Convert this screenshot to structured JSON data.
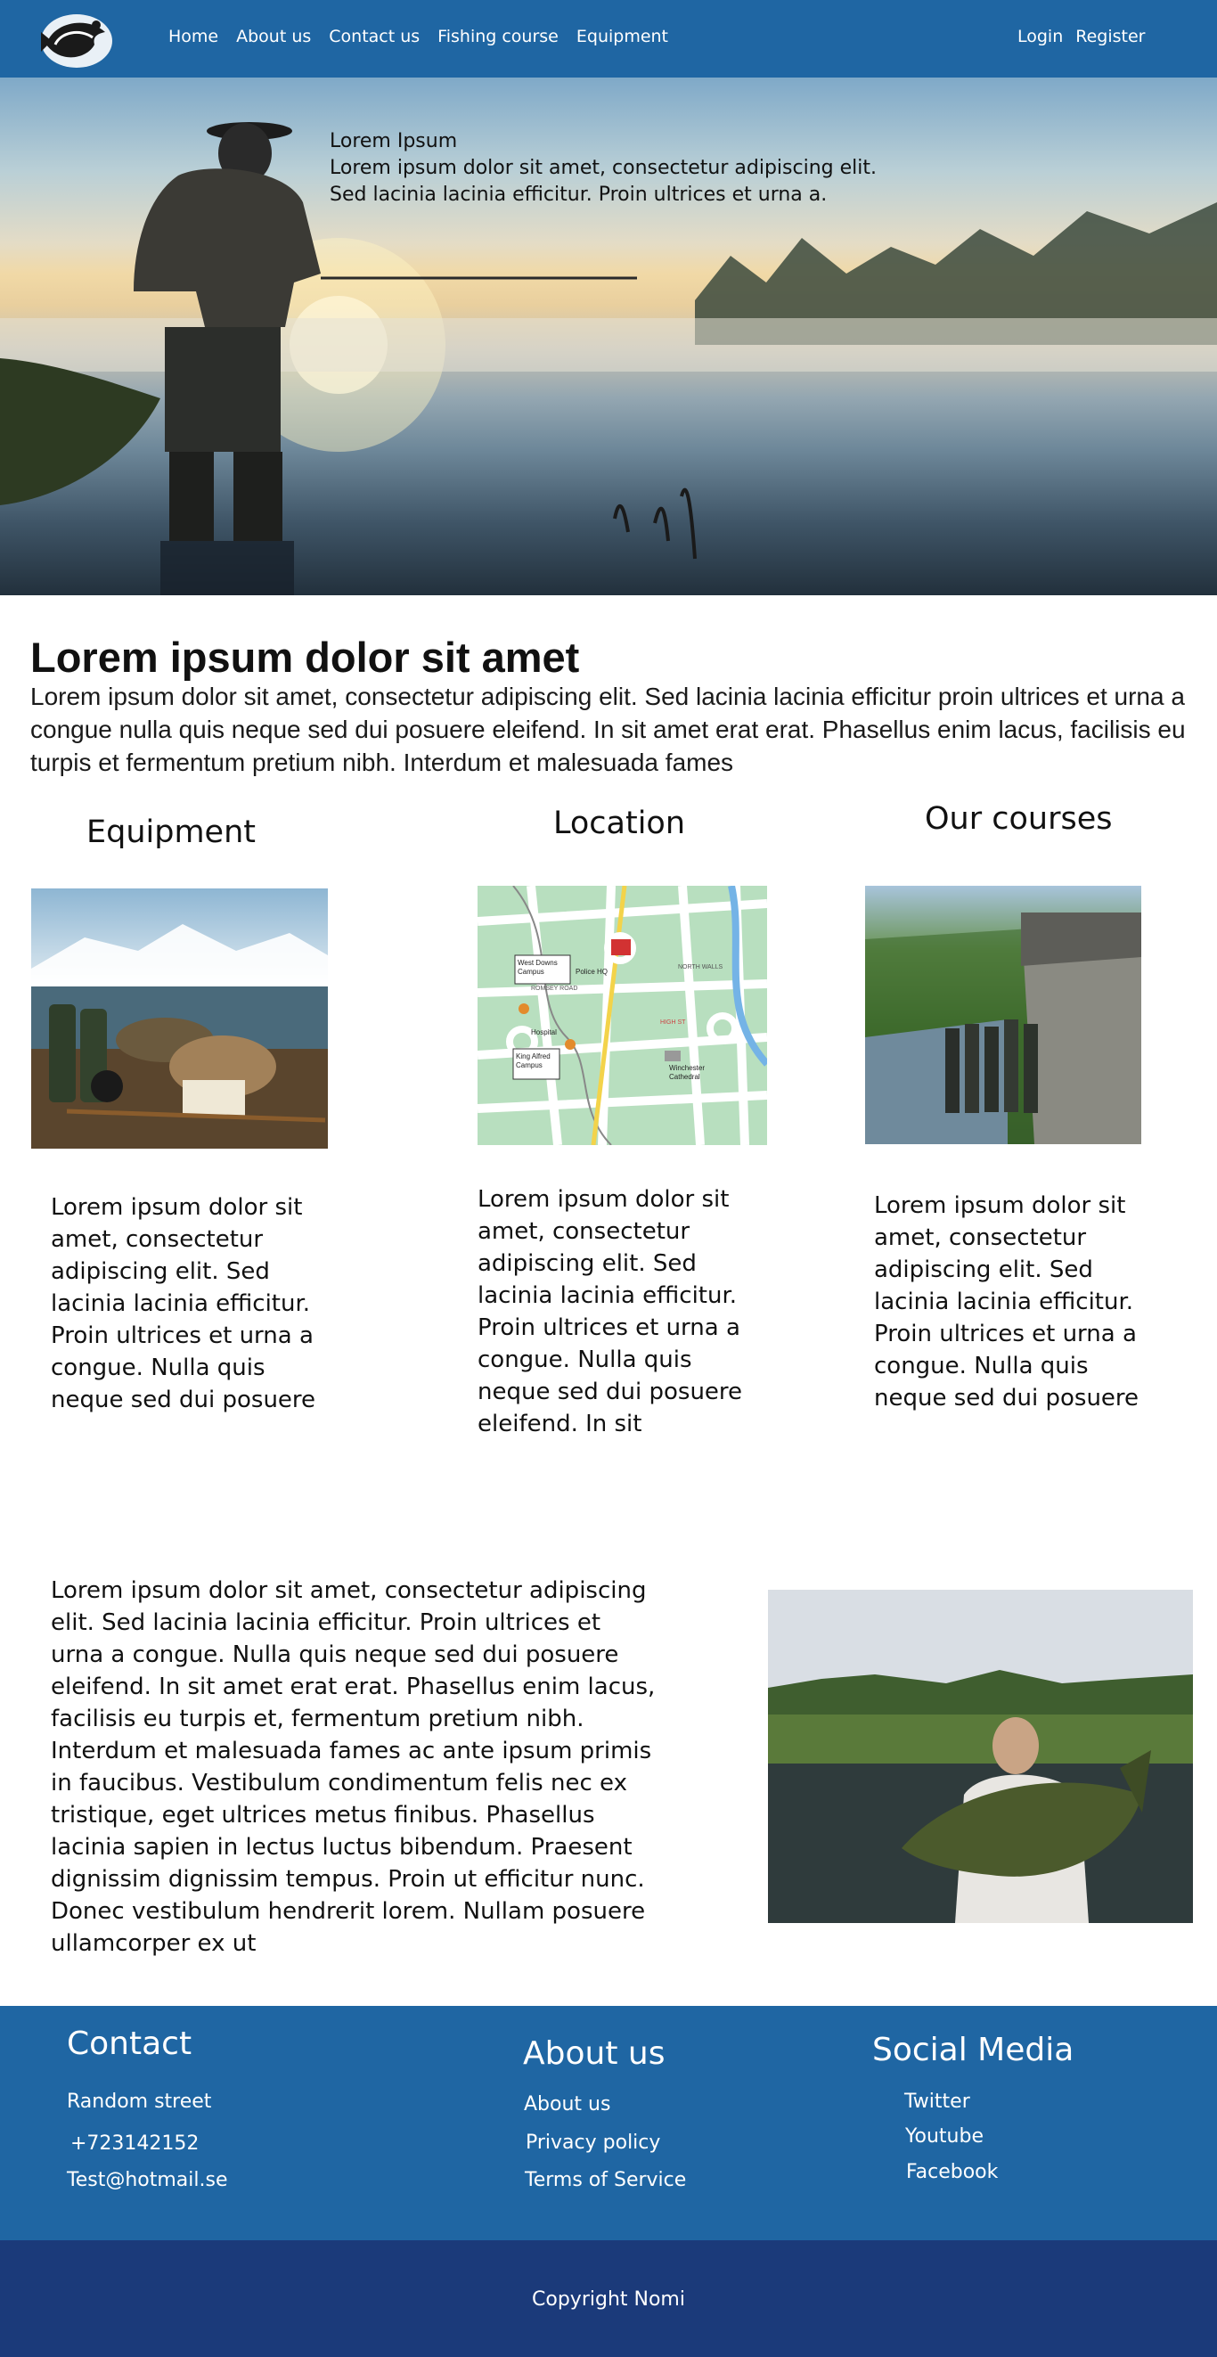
{
  "nav": {
    "links": [
      "Home",
      "About us",
      "Contact us",
      "Fishing course",
      "Equipment"
    ],
    "login": "Login",
    "register": "Register"
  },
  "hero": {
    "line1": "Lorem Ipsum",
    "line2": "Lorem ipsum dolor sit amet, consectetur adipiscing elit.",
    "line3": "Sed lacinia lacinia efficitur. Proin ultrices et urna a."
  },
  "intro": {
    "title": "Lorem ipsum dolor sit amet",
    "text": "Lorem ipsum dolor sit amet, consectetur adipiscing elit. Sed lacinia lacinia efficitur proin ultrices et urna a congue nulla quis neque sed dui posuere eleifend. In sit amet erat erat. Phasellus enim lacus, facilisis eu turpis et fermentum pretium nibh. Interdum et malesuada fames"
  },
  "columns": [
    {
      "title": "Equipment",
      "text": "Lorem ipsum dolor sit amet, consectetur adipiscing elit. Sed lacinia lacinia efficitur. Proin ultrices et urna a congue. Nulla quis neque sed dui posuere"
    },
    {
      "title": "Location",
      "text": "Lorem ipsum dolor sit amet, consectetur adipiscing elit. Sed lacinia lacinia efficitur. Proin ultrices et urna a congue. Nulla quis neque sed dui posuere eleifend. In sit"
    },
    {
      "title": "Our courses",
      "text": "Lorem ipsum dolor sit amet, consectetur adipiscing elit. Sed lacinia lacinia efficitur. Proin ultrices et urna a congue. Nulla quis neque sed dui posuere"
    }
  ],
  "map_labels": [
    "West Downs Campus",
    "Police HQ",
    "Hospital",
    "King Alfred Campus",
    "Winchester Cathedral",
    "ROMSEY ROAD",
    "NORTH WALLS",
    "HIGH ST"
  ],
  "feature": {
    "text": "Lorem ipsum dolor sit amet, consectetur adipiscing elit. Sed lacinia lacinia efficitur. Proin ultrices et urna a congue. Nulla quis neque sed dui posuere eleifend. In sit amet erat erat. Phasellus enim lacus, facilisis eu turpis et, fermentum pretium nibh. Interdum et malesuada fames ac ante ipsum primis in faucibus. Vestibulum condimentum felis nec ex tristique, eget ultrices metus finibus. Phasellus lacinia sapien in lectus luctus bibendum. Praesent dignissim dignissim tempus. Proin ut efficitur nunc. Donec vestibulum hendrerit lorem. Nullam posuere ullamcorper ex ut"
  },
  "footer": {
    "contact": {
      "title": "Contact",
      "street": "Random street",
      "phone": "+723142152",
      "email": "Test@hotmail.se"
    },
    "about": {
      "title": "About us",
      "items": [
        "About us",
        "Privacy policy",
        "Terms of Service"
      ]
    },
    "social": {
      "title": "Social Media",
      "items": [
        "Twitter",
        "Youtube",
        "Facebook"
      ]
    }
  },
  "copyright": "Copyright Nomi",
  "colors": {
    "nav": "#1f66a3",
    "footer": "#1f66a3",
    "copyright_bar": "#1b3a7a"
  },
  "icons": {
    "logo": "fish-logo-icon"
  }
}
